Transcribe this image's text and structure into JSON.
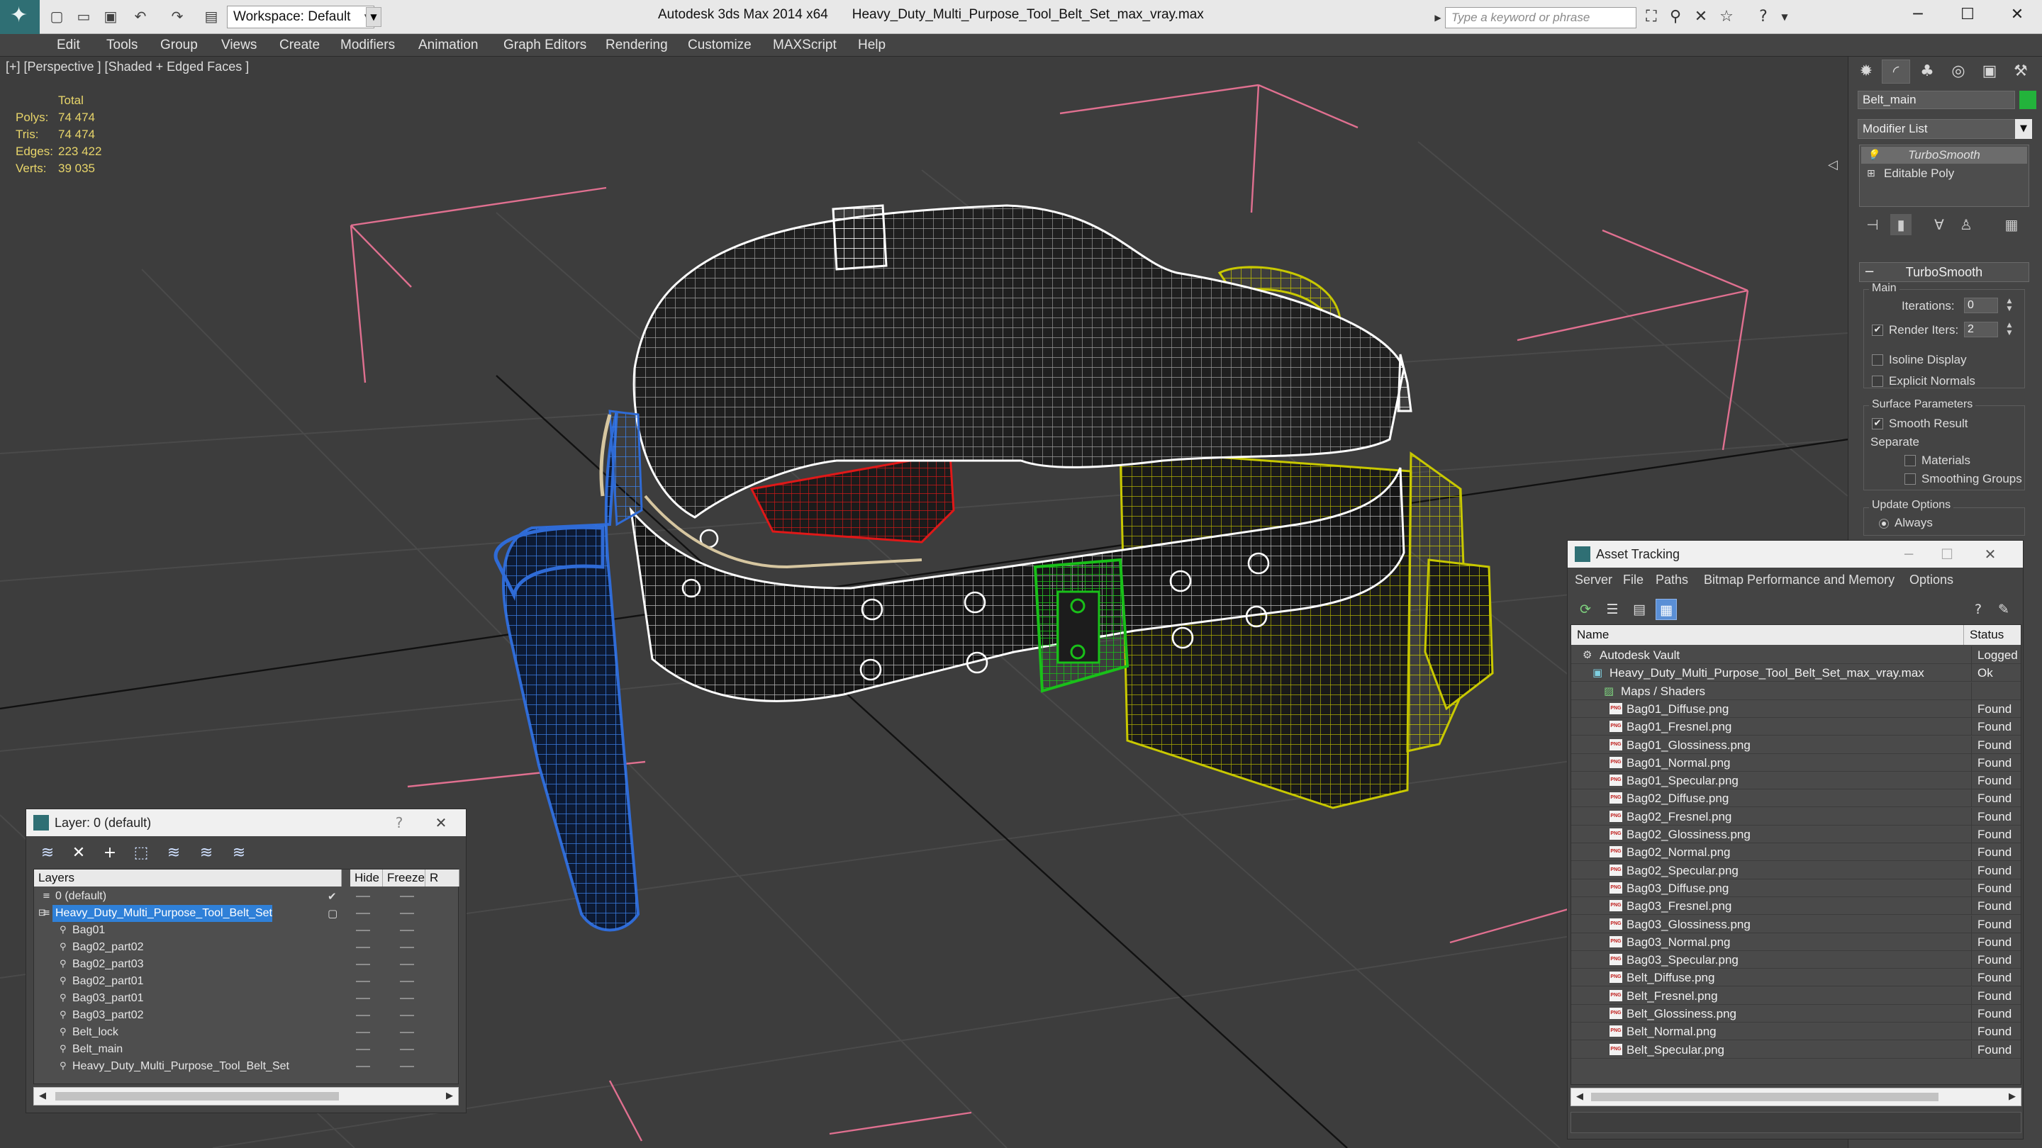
{
  "app": {
    "title": "Autodesk 3ds Max 2014 x64",
    "file": "Heavy_Duty_Multi_Purpose_Tool_Belt_Set_max_vray.max",
    "workspace": "Workspace: Default",
    "search_placeholder": "Type a keyword or phrase"
  },
  "quick_access_icons": [
    "new-icon",
    "open-icon",
    "save-icon",
    "undo-icon",
    "redo-icon",
    "project-icon"
  ],
  "menu": [
    "Edit",
    "Tools",
    "Group",
    "Views",
    "Create",
    "Modifiers",
    "Animation",
    "Graph Editors",
    "Rendering",
    "Customize",
    "MAXScript",
    "Help"
  ],
  "viewport": {
    "label": "[+] [Perspective ] [Shaded + Edged Faces ]",
    "stats": {
      "header": "Total",
      "rows": [
        {
          "label": "Polys:",
          "value": "74 474"
        },
        {
          "label": "Tris:",
          "value": "74 474"
        },
        {
          "label": "Edges:",
          "value": "223 422"
        },
        {
          "label": "Verts:",
          "value": "39 035"
        }
      ]
    }
  },
  "command_panel": {
    "object_name": "Belt_main",
    "object_color": "#23b33b",
    "modifier_list": "Modifier List",
    "stack": [
      "TurboSmooth",
      "Editable Poly"
    ],
    "rollout": "TurboSmooth",
    "main_group": "Main",
    "iterations_label": "Iterations:",
    "iterations": "0",
    "render_iters_label": "Render Iters:",
    "render_iters": "2",
    "isoline": "Isoline Display",
    "explicit_normals": "Explicit Normals",
    "surface_group": "Surface Parameters",
    "smooth_result": "Smooth Result",
    "separate": "Separate",
    "materials": "Materials",
    "smoothing_groups": "Smoothing Groups",
    "update_group": "Update Options",
    "always": "Always"
  },
  "layer_dialog": {
    "title": "Layer: 0 (default)",
    "columns": [
      "Layers",
      "Hide",
      "Freeze",
      "R"
    ],
    "rows": [
      {
        "name": "0 (default)",
        "level": 0,
        "type": "layer",
        "selected": false,
        "current": true
      },
      {
        "name": "Heavy_Duty_Multi_Purpose_Tool_Belt_Set",
        "level": 0,
        "type": "layer",
        "selected": true,
        "current": false
      },
      {
        "name": "Bag01",
        "level": 1,
        "type": "object",
        "selected": false
      },
      {
        "name": "Bag02_part02",
        "level": 1,
        "type": "object",
        "selected": false
      },
      {
        "name": "Bag02_part03",
        "level": 1,
        "type": "object",
        "selected": false
      },
      {
        "name": "Bag02_part01",
        "level": 1,
        "type": "object",
        "selected": false
      },
      {
        "name": "Bag03_part01",
        "level": 1,
        "type": "object",
        "selected": false
      },
      {
        "name": "Bag03_part02",
        "level": 1,
        "type": "object",
        "selected": false
      },
      {
        "name": "Belt_lock",
        "level": 1,
        "type": "object",
        "selected": false
      },
      {
        "name": "Belt_main",
        "level": 1,
        "type": "object",
        "selected": false
      },
      {
        "name": "Heavy_Duty_Multi_Purpose_Tool_Belt_Set",
        "level": 1,
        "type": "object",
        "selected": false
      }
    ]
  },
  "asset_tracking": {
    "title": "Asset Tracking",
    "menu": [
      "Server",
      "File",
      "Paths",
      "Bitmap Performance and Memory",
      "Options"
    ],
    "columns": [
      "Name",
      "Status"
    ],
    "rows": [
      {
        "name": "Autodesk Vault",
        "status": "Logged O",
        "level": 0,
        "type": "vault"
      },
      {
        "name": "Heavy_Duty_Multi_Purpose_Tool_Belt_Set_max_vray.max",
        "status": "Ok",
        "level": 1,
        "type": "max"
      },
      {
        "name": "Maps / Shaders",
        "status": "",
        "level": 2,
        "type": "folder"
      },
      {
        "name": "Bag01_Diffuse.png",
        "status": "Found",
        "level": 3,
        "type": "png"
      },
      {
        "name": "Bag01_Fresnel.png",
        "status": "Found",
        "level": 3,
        "type": "png"
      },
      {
        "name": "Bag01_Glossiness.png",
        "status": "Found",
        "level": 3,
        "type": "png"
      },
      {
        "name": "Bag01_Normal.png",
        "status": "Found",
        "level": 3,
        "type": "png"
      },
      {
        "name": "Bag01_Specular.png",
        "status": "Found",
        "level": 3,
        "type": "png"
      },
      {
        "name": "Bag02_Diffuse.png",
        "status": "Found",
        "level": 3,
        "type": "png"
      },
      {
        "name": "Bag02_Fresnel.png",
        "status": "Found",
        "level": 3,
        "type": "png"
      },
      {
        "name": "Bag02_Glossiness.png",
        "status": "Found",
        "level": 3,
        "type": "png"
      },
      {
        "name": "Bag02_Normal.png",
        "status": "Found",
        "level": 3,
        "type": "png"
      },
      {
        "name": "Bag02_Specular.png",
        "status": "Found",
        "level": 3,
        "type": "png"
      },
      {
        "name": "Bag03_Diffuse.png",
        "status": "Found",
        "level": 3,
        "type": "png"
      },
      {
        "name": "Bag03_Fresnel.png",
        "status": "Found",
        "level": 3,
        "type": "png"
      },
      {
        "name": "Bag03_Glossiness.png",
        "status": "Found",
        "level": 3,
        "type": "png"
      },
      {
        "name": "Bag03_Normal.png",
        "status": "Found",
        "level": 3,
        "type": "png"
      },
      {
        "name": "Bag03_Specular.png",
        "status": "Found",
        "level": 3,
        "type": "png"
      },
      {
        "name": "Belt_Diffuse.png",
        "status": "Found",
        "level": 3,
        "type": "png"
      },
      {
        "name": "Belt_Fresnel.png",
        "status": "Found",
        "level": 3,
        "type": "png"
      },
      {
        "name": "Belt_Glossiness.png",
        "status": "Found",
        "level": 3,
        "type": "png"
      },
      {
        "name": "Belt_Normal.png",
        "status": "Found",
        "level": 3,
        "type": "png"
      },
      {
        "name": "Belt_Specular.png",
        "status": "Found",
        "level": 3,
        "type": "png"
      }
    ]
  },
  "colors": {
    "selection_blue": "#2f80d8",
    "stats_yellow": "#e8d56a",
    "bag01_wire": "#2f6bd6",
    "bag02_wire": "#c8c800",
    "bag03_wire": "#e01818",
    "lock_wire": "#19c019",
    "belt_wire": "#ffffff"
  }
}
